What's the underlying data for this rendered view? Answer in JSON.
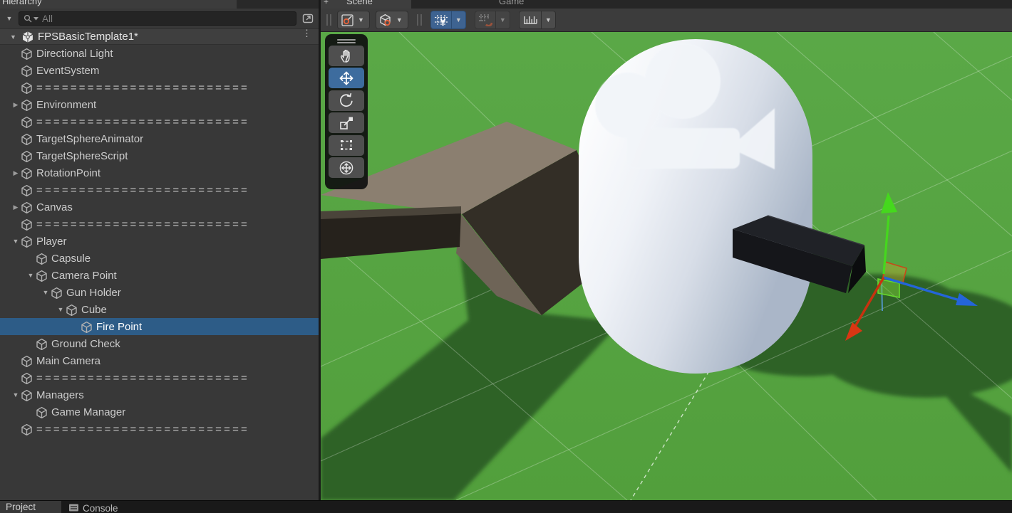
{
  "hierarchy": {
    "tab_label": "Hierarchy",
    "collapse_arrow": "▼",
    "search": {
      "placeholder": "All",
      "icons": [
        "search-icon",
        "search-filter-dropdown-icon",
        "popout-icon"
      ]
    },
    "root": {
      "label": "FPSBasicTemplate1*",
      "icon": "unity-scene-icon",
      "menu_icon": "kebab-menu-icon",
      "expanded": true
    },
    "items": [
      {
        "label": "Directional Light",
        "level": 1,
        "arrow": null,
        "separator": false,
        "selected": false
      },
      {
        "label": "EventSystem",
        "level": 1,
        "arrow": null,
        "separator": false,
        "selected": false
      },
      {
        "label": "=========================",
        "level": 1,
        "arrow": null,
        "separator": true,
        "selected": false
      },
      {
        "label": "Environment",
        "level": 1,
        "arrow": "col",
        "separator": false,
        "selected": false
      },
      {
        "label": "=========================",
        "level": 1,
        "arrow": null,
        "separator": true,
        "selected": false
      },
      {
        "label": "TargetSphereAnimator",
        "level": 1,
        "arrow": null,
        "separator": false,
        "selected": false
      },
      {
        "label": "TargetSphereScript",
        "level": 1,
        "arrow": null,
        "separator": false,
        "selected": false
      },
      {
        "label": "RotationPoint",
        "level": 1,
        "arrow": "col",
        "separator": false,
        "selected": false
      },
      {
        "label": "=========================",
        "level": 1,
        "arrow": null,
        "separator": true,
        "selected": false
      },
      {
        "label": "Canvas",
        "level": 1,
        "arrow": "col",
        "separator": false,
        "selected": false
      },
      {
        "label": "=========================",
        "level": 1,
        "arrow": null,
        "separator": true,
        "selected": false
      },
      {
        "label": "Player",
        "level": 1,
        "arrow": "exp",
        "separator": false,
        "selected": false
      },
      {
        "label": "Capsule",
        "level": 2,
        "arrow": null,
        "separator": false,
        "selected": false
      },
      {
        "label": "Camera Point",
        "level": 2,
        "arrow": "exp",
        "separator": false,
        "selected": false
      },
      {
        "label": "Gun Holder",
        "level": 3,
        "arrow": "exp",
        "separator": false,
        "selected": false
      },
      {
        "label": "Cube",
        "level": 4,
        "arrow": "exp",
        "separator": false,
        "selected": false
      },
      {
        "label": "Fire Point",
        "level": 5,
        "arrow": null,
        "separator": false,
        "selected": true
      },
      {
        "label": "Ground Check",
        "level": 2,
        "arrow": null,
        "separator": false,
        "selected": false
      },
      {
        "label": "Main Camera",
        "level": 1,
        "arrow": null,
        "separator": false,
        "selected": false
      },
      {
        "label": "=========================",
        "level": 1,
        "arrow": null,
        "separator": true,
        "selected": false
      },
      {
        "label": "Managers",
        "level": 1,
        "arrow": "exp",
        "separator": false,
        "selected": false
      },
      {
        "label": "Game Manager",
        "level": 2,
        "arrow": null,
        "separator": false,
        "selected": false
      },
      {
        "label": "=========================",
        "level": 1,
        "arrow": null,
        "separator": true,
        "selected": false
      }
    ]
  },
  "scene_panel": {
    "tabs": [
      {
        "label": "Scene",
        "active": true
      },
      {
        "label": "Game",
        "active": false
      }
    ],
    "toolbar": [
      {
        "kind": "handle"
      },
      {
        "kind": "button",
        "icon": "handle-position-icon",
        "dropdown": true,
        "state": "normal"
      },
      {
        "kind": "button",
        "icon": "handle-rotation-icon",
        "dropdown": true,
        "state": "normal"
      },
      {
        "kind": "separator"
      },
      {
        "kind": "split",
        "icon": "grid-visibility-icon",
        "dropdown": true,
        "state": "active"
      },
      {
        "kind": "split",
        "icon": "grid-snap-icon",
        "dropdown": true,
        "state": "dim"
      },
      {
        "kind": "split",
        "icon": "snap-increment-icon",
        "dropdown": true,
        "state": "normal"
      }
    ],
    "tools_overlay": [
      {
        "name": "view-tool",
        "icon": "hand-icon",
        "active": false
      },
      {
        "name": "move-tool",
        "icon": "move-icon",
        "active": true
      },
      {
        "name": "rotate-tool",
        "icon": "rotate-icon",
        "active": false
      },
      {
        "name": "scale-tool",
        "icon": "scale-icon",
        "active": false
      },
      {
        "name": "rect-tool",
        "icon": "rect-icon",
        "active": false
      },
      {
        "name": "transform-tool",
        "icon": "transform-icon",
        "active": false
      }
    ],
    "viewport": {
      "objects": [
        "ground-plane",
        "ramp-structure",
        "player-capsule",
        "camera-gizmo-icon",
        "gun-cube",
        "move-gizmo"
      ],
      "colors": {
        "ground_green": "#57a441",
        "shadow_green": "#2d6228",
        "ramp_top": "#8b7f70",
        "ramp_dark": "#332e26",
        "capsule_white": "#f4f6fa",
        "gun_black": "#15161a",
        "axis_x_red": "#c8320f",
        "axis_y_green": "#45d81d",
        "axis_z_blue": "#2465d9",
        "selection_blue": "#2d5c87"
      }
    }
  },
  "bottom_bar": {
    "tabs": [
      {
        "label": "Project",
        "active": true,
        "icon": null
      },
      {
        "label": "Console",
        "active": false,
        "icon": "console-icon"
      }
    ]
  }
}
